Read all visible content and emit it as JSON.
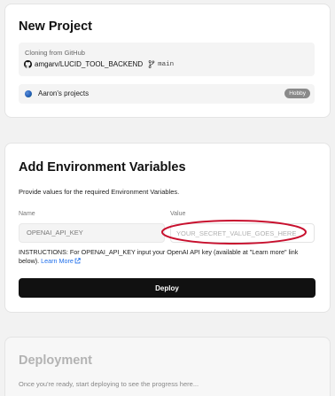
{
  "project_card": {
    "title": "New Project",
    "clone_label": "Cloning from GitHub",
    "repo_icon": "github-icon",
    "repo_name": "amgarv/LUCID_TOOL_BACKEND",
    "branch_icon": "branch-icon",
    "branch_name": "main",
    "team_name": "Aaron's projects",
    "plan_badge": "Hobby"
  },
  "env_card": {
    "title": "Add Environment Variables",
    "description": "Provide values for the required Environment Variables.",
    "name_header": "Name",
    "value_header": "Value",
    "name_value": "OPENAI_API_KEY",
    "value_placeholder": "YOUR_SECRET_VALUE_GOES_HERE",
    "instructions_text": "INSTRUCTIONS: For OPENAI_API_KEY input your OpenAI API key (available at \"Learn more\" link below).",
    "learn_more_label": "Learn More",
    "deploy_button_label": "Deploy"
  },
  "deployment_card": {
    "title": "Deployment",
    "description": "Once you're ready, start deploying to see the progress here..."
  },
  "colors": {
    "highlight_ellipse": "#c8102e",
    "link": "#1f6feb",
    "button_bg": "#111111"
  }
}
